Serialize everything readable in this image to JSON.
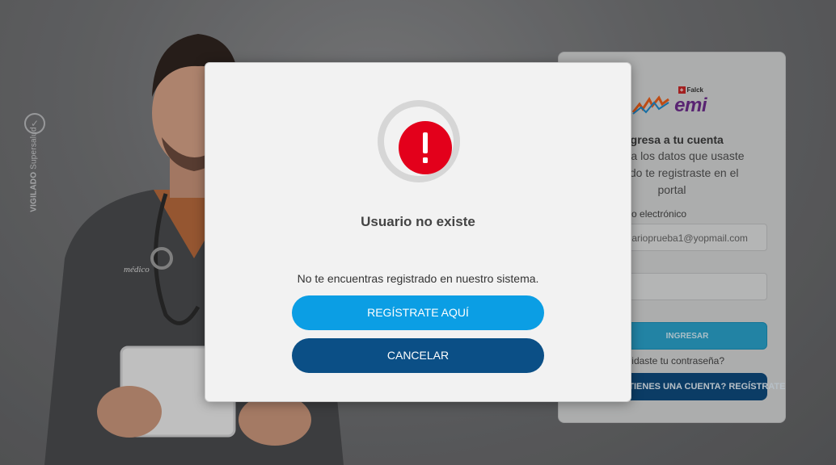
{
  "background": {
    "vigilado": {
      "bold": "VIGILADO",
      "regular": "Supersalud"
    },
    "coat_label": "médico",
    "login": {
      "brand_small": "Falck",
      "brand_main": "emi",
      "title": "Ingresa a tu cuenta",
      "subtitle": "Ingresa los datos que usaste cuando te registraste en el portal",
      "email_label": "Correo electrónico",
      "email_value": "usuarioprueba1@yopmail.com",
      "password_value": "•",
      "submit_label": "INGRESAR",
      "forgot_label": "¿Olvidaste tu contraseña?",
      "register_label": "¿NO TIENES UNA CUENTA? REGÍSTRATE"
    }
  },
  "modal": {
    "icon": "exclamation-icon",
    "title": "Usuario no existe",
    "message": "No te encuentras registrado en nuestro sistema.",
    "register_button": "REGÍSTRATE AQUÍ",
    "cancel_button": "CANCELAR"
  },
  "colors": {
    "alert_red": "#e3001b",
    "primary_blue": "#0b9ee4",
    "dark_blue": "#0b4f86"
  }
}
